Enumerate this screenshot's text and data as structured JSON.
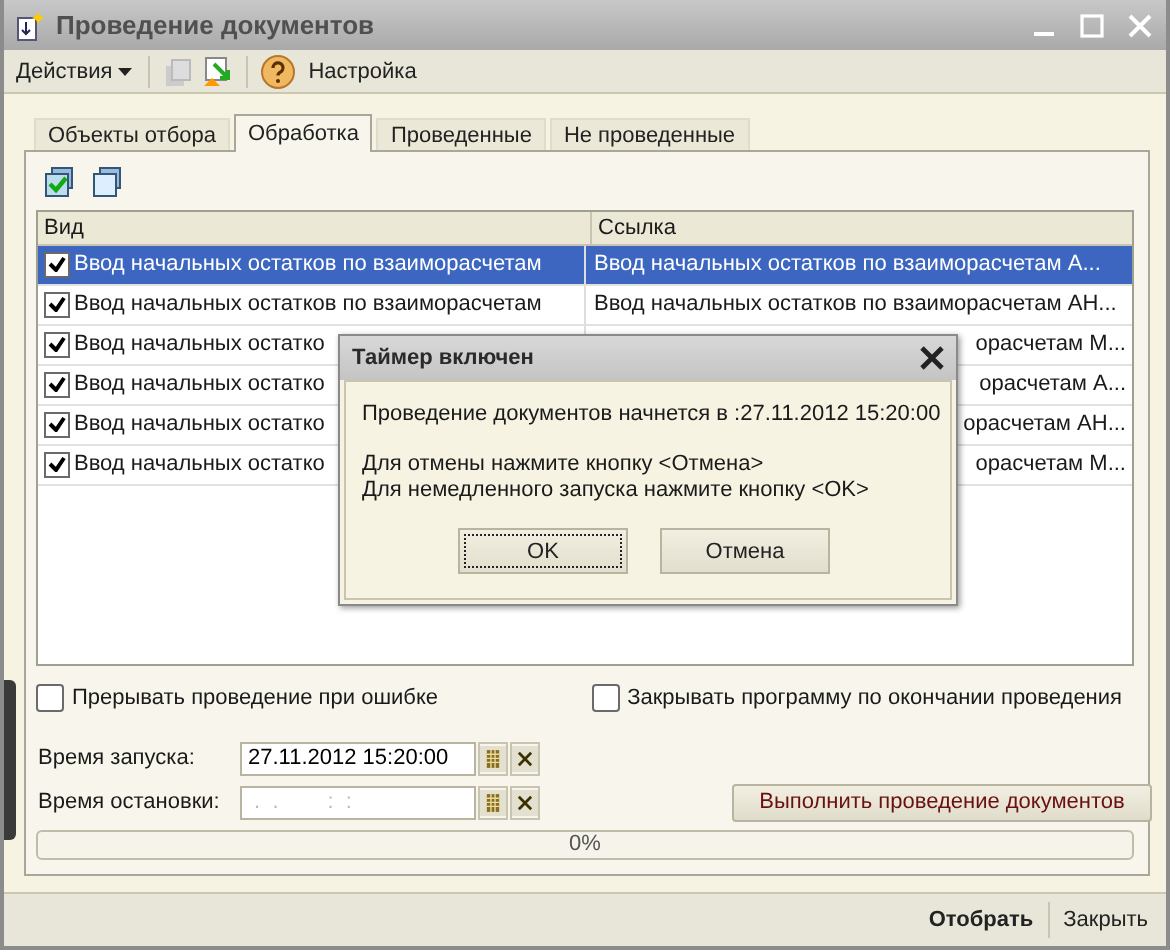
{
  "window": {
    "title": "Проведение документов"
  },
  "toolbar": {
    "menu": "Действия",
    "help_label": "Настройка"
  },
  "tabs": [
    {
      "label": "Объекты отбора",
      "selected": false
    },
    {
      "label": "Обработка",
      "selected": true
    },
    {
      "label": "Проведенные",
      "selected": false
    },
    {
      "label": "Не проведенные",
      "selected": false
    }
  ],
  "table": {
    "columns": [
      "Вид",
      "Ссылка"
    ],
    "rows": [
      {
        "checked": true,
        "selected": true,
        "cells": [
          "Ввод начальных остатков по взаиморасчетам",
          "Ввод начальных остатков по взаиморасчетам А..."
        ]
      },
      {
        "checked": true,
        "selected": false,
        "cells": [
          "Ввод начальных остатков по взаиморасчетам",
          "Ввод начальных остатков по взаиморасчетам АН..."
        ]
      },
      {
        "checked": true,
        "selected": false,
        "cells": [
          "Ввод начальных остатко",
          "орасчетам М..."
        ]
      },
      {
        "checked": true,
        "selected": false,
        "cells": [
          "Ввод начальных остатко",
          "орасчетам А..."
        ]
      },
      {
        "checked": true,
        "selected": false,
        "cells": [
          "Ввод начальных остатко",
          "орасчетам АН..."
        ]
      },
      {
        "checked": true,
        "selected": false,
        "cells": [
          "Ввод начальных остатко",
          "орасчетам М..."
        ]
      }
    ]
  },
  "options": [
    {
      "label": "Прерывать проведение при ошибке",
      "checked": false
    },
    {
      "label": "Закрывать программу по окончании проведения",
      "checked": false
    }
  ],
  "fields": [
    {
      "label": "Время запуска:",
      "value": "27.11.2012 15:20:00",
      "kind": "filled"
    },
    {
      "label": "Время остановки:",
      "value": " .  .        :  :",
      "kind": "mask"
    }
  ],
  "run_button": "Выполнить проведение документов",
  "progress": {
    "level": 0,
    "text": "0%"
  },
  "footer_buttons": [
    {
      "label": "Отобрать",
      "kind": "default"
    },
    {
      "label": "Закрыть",
      "kind": "normal"
    }
  ],
  "dialog": {
    "title": "Таймер включен",
    "message": "Проведение документов начнется в :27.11.2012 15:20:00",
    "hints": [
      "Для отмены нажмите кнопку <Отмена>",
      "Для немедленного запуска нажмите кнопку <OK>"
    ],
    "buttons": [
      {
        "label": "OK",
        "focused": true
      },
      {
        "label": "Отмена",
        "focused": false
      }
    ]
  }
}
